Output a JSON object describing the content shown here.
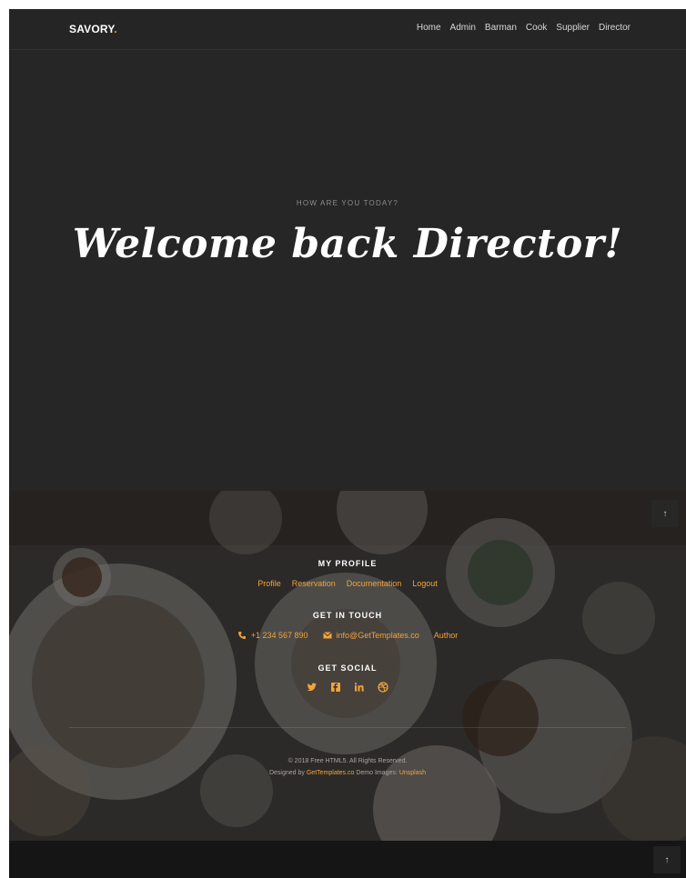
{
  "navbar": {
    "brand": "SAVORY",
    "brand_dot": ".",
    "items": [
      "Home",
      "Admin",
      "Barman",
      "Cook",
      "Supplier",
      "Director"
    ]
  },
  "hero": {
    "kicker": "HOW ARE YOU TODAY?",
    "title": "Welcome back Director!"
  },
  "footer": {
    "profile_heading": "MY PROFILE",
    "profile_links": [
      "Profile",
      "Reservation",
      "Documentation",
      "Logout"
    ],
    "contact_heading": "GET IN TOUCH",
    "phone": "+1 234 567 890",
    "email": "info@GetTemplates.co",
    "author": "Author",
    "social_heading": "GET SOCIAL",
    "social_icons": [
      "twitter-icon",
      "facebook-icon",
      "linkedin-icon",
      "dribbble-icon"
    ],
    "copyright": "© 2018 Free HTML5. All Rights Reserved.",
    "designed_by_prefix": "Designed by",
    "designed_by_link": "GetTemplates.co",
    "demo_images_label": "Demo Images:",
    "demo_images_link": "Unsplash"
  },
  "scroll_top_arrow": "↑",
  "colors": {
    "accent": "#f1a43b",
    "hero_bg": "#262626",
    "navbar_bg": "#252525"
  }
}
